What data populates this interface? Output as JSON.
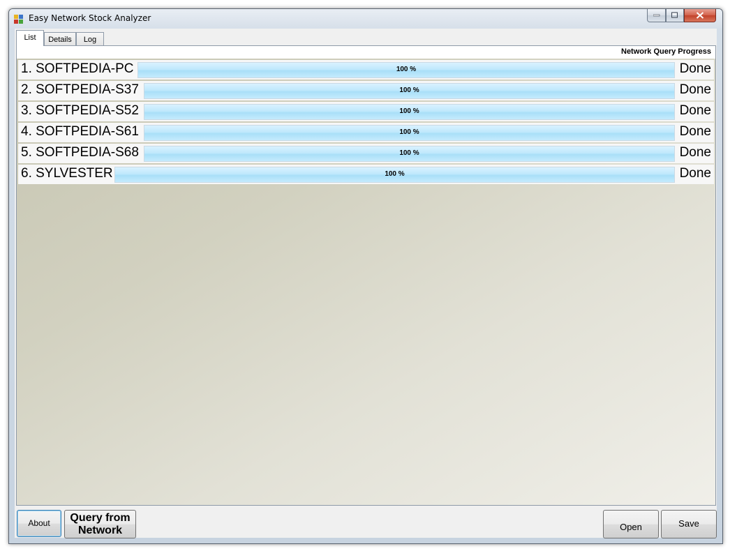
{
  "window": {
    "title": "Easy Network Stock Analyzer"
  },
  "tabs": [
    {
      "label": "List",
      "selected": true
    },
    {
      "label": "Details",
      "selected": false
    },
    {
      "label": "Log",
      "selected": false
    }
  ],
  "list": {
    "progress_header": "Network Query Progress",
    "rows": [
      {
        "name": "1. SOFTPEDIA-PC",
        "progress_percent": 100,
        "progress_label": "100 %",
        "status": "Done"
      },
      {
        "name": "2. SOFTPEDIA-S37",
        "progress_percent": 100,
        "progress_label": "100 %",
        "status": "Done"
      },
      {
        "name": "3. SOFTPEDIA-S52",
        "progress_percent": 100,
        "progress_label": "100 %",
        "status": "Done"
      },
      {
        "name": "4. SOFTPEDIA-S61",
        "progress_percent": 100,
        "progress_label": "100 %",
        "status": "Done"
      },
      {
        "name": "5. SOFTPEDIA-S68",
        "progress_percent": 100,
        "progress_label": "100 %",
        "status": "Done"
      },
      {
        "name": "6. SYLVESTER",
        "progress_percent": 100,
        "progress_label": "100 %",
        "status": "Done"
      }
    ]
  },
  "buttons": {
    "about": "About",
    "query_line1": "Query from",
    "query_line2": "Network",
    "open": "Open",
    "save": "Save"
  },
  "icons": {
    "app": "app-icon",
    "minimize": "minimize-icon",
    "maximize": "maximize-icon",
    "close": "close-icon"
  },
  "colors": {
    "progress_fill": "#bfe8fc",
    "close_button": "#c2422b"
  }
}
